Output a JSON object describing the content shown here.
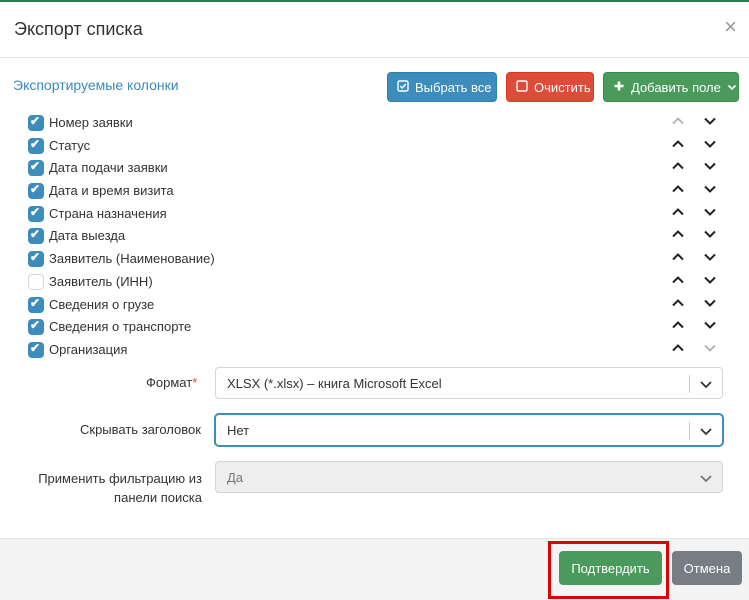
{
  "modal": {
    "title": "Экспорт списка",
    "close_icon": "×"
  },
  "columns_section": {
    "title": "Экспортируемые колонки",
    "select_all_label": "Выбрать все",
    "clear_label": "Очистить",
    "add_field_label": "Добавить поле"
  },
  "columns": [
    {
      "label": "Номер заявки",
      "checked": true
    },
    {
      "label": "Статус",
      "checked": true
    },
    {
      "label": "Дата подачи заявки",
      "checked": true
    },
    {
      "label": "Дата и время визита",
      "checked": true
    },
    {
      "label": "Страна назначения",
      "checked": true
    },
    {
      "label": "Дата выезда",
      "checked": true
    },
    {
      "label": "Заявитель (Наименование)",
      "checked": true
    },
    {
      "label": "Заявитель (ИНН)",
      "checked": false
    },
    {
      "label": "Сведения о грузе",
      "checked": true
    },
    {
      "label": "Сведения о транспорте",
      "checked": true
    },
    {
      "label": "Организация",
      "checked": true
    }
  ],
  "form": {
    "format_label": "Формат",
    "format_required_mark": "*",
    "format_value": "XLSX (*.xlsx) – книга Microsoft Excel",
    "hide_header_label": "Скрывать заголовок",
    "hide_header_value": "Нет",
    "apply_filter_label_line1": "Применить фильтрацию из",
    "apply_filter_label_line2": "панели поиска",
    "apply_filter_value": "Да"
  },
  "footer": {
    "confirm_label": "Подтвердить",
    "cancel_label": "Отмена"
  },
  "colors": {
    "primary": "#3c8dbc",
    "danger": "#dd4b39",
    "success": "#4a9a5b",
    "highlight": "#e00000"
  }
}
